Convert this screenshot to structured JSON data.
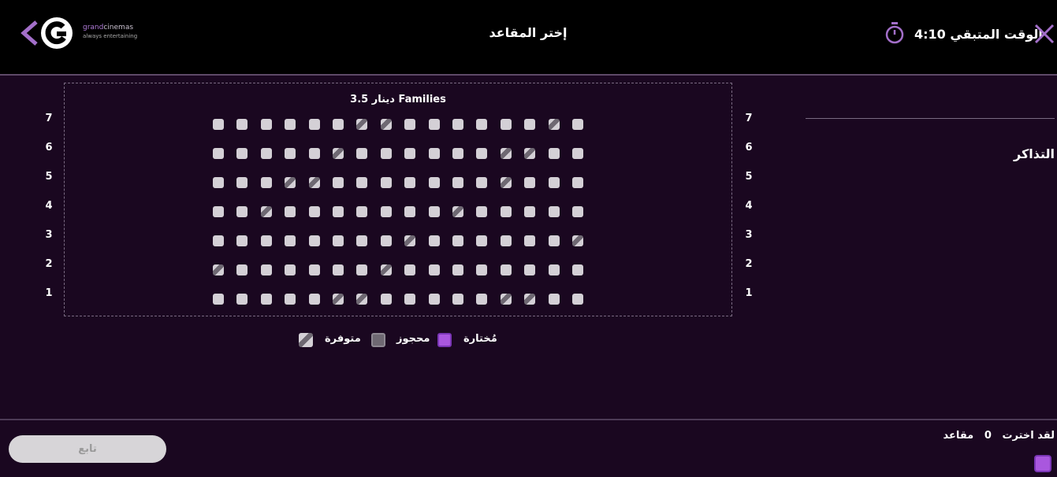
{
  "header": {
    "title": "إختر المقاعد",
    "timer_label": "الوقت المتبقي",
    "timer_value": "4:10",
    "brand_name_1": "grand",
    "brand_name_2": "cinemas",
    "brand_tagline": "always entertaining"
  },
  "seat_map": {
    "price_label": "دينار 3.5 Families",
    "rows": [
      "7",
      "6",
      "5",
      "4",
      "3",
      "2",
      "1"
    ],
    "seats_per_row": 16,
    "booked": {
      "7": [
        7,
        8,
        15
      ],
      "6": [
        6,
        13,
        14
      ],
      "5": [
        4,
        5,
        13
      ],
      "4": [
        3,
        11
      ],
      "3": [
        9,
        16
      ],
      "2": [
        1,
        8
      ],
      "1": [
        6,
        7,
        13,
        14
      ]
    }
  },
  "legend": {
    "selected": "مُختارة",
    "booked": "محجوز",
    "available": "متوفرة"
  },
  "tickets": {
    "title": "التذاكر"
  },
  "footer": {
    "selected_text_1": "لقد اخترت",
    "selected_count": "0",
    "selected_text_2": "مقاعد",
    "continue_label": "تابع"
  },
  "colors": {
    "accent": "#a957de",
    "seat_available": "#d4d0d6",
    "seat_booked": "#6e6872",
    "background": "#1a0720"
  }
}
